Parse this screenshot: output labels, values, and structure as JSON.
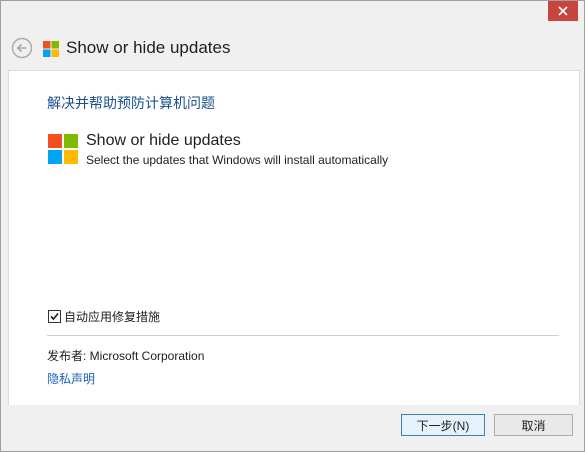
{
  "window": {
    "close_label": "close",
    "header_title": "Show or hide updates"
  },
  "content": {
    "heading": "解决并帮助预防计算机问题",
    "tool": {
      "title": "Show or hide updates",
      "description": "Select the updates that Windows will install automatically"
    },
    "auto_repair": {
      "label": "自动应用修复措施",
      "checked": true
    },
    "publisher_label": "发布者:  Microsoft Corporation",
    "privacy_link": "隐私声明"
  },
  "footer": {
    "next_label": "下一步(N)",
    "cancel_label": "取消"
  },
  "colors": {
    "logo_red": "#f25022",
    "logo_green": "#7fba00",
    "logo_blue": "#00a4ef",
    "logo_yellow": "#ffb900",
    "heading_blue": "#1a4f8b",
    "link_blue": "#1a62b7",
    "close_red": "#c7453f"
  }
}
